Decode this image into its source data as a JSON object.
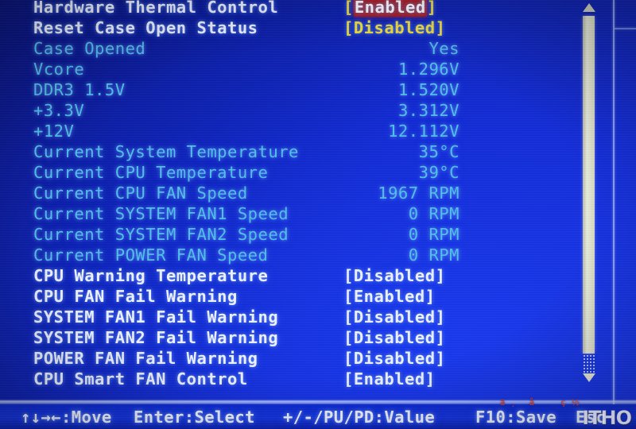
{
  "screen": {
    "background_color": "#0a22c8",
    "highlight_color": "#b11a1a",
    "readonly_color": "#4fc3e8",
    "editable_color": "#eef2ff",
    "value_color": "#f2e03a"
  },
  "rows": [
    {
      "label": "Hardware Thermal Control",
      "value": "Enabled",
      "style": "bracket-selected"
    },
    {
      "label": "Reset Case Open Status",
      "value": "Disabled",
      "style": "bracket-yellow"
    },
    {
      "label": "Case Opened",
      "value": "Yes",
      "style": "readonly"
    },
    {
      "label": "Vcore",
      "value": "1.296V",
      "style": "readonly"
    },
    {
      "label": "DDR3 1.5V",
      "value": "1.520V",
      "style": "readonly"
    },
    {
      "label": "+3.3V",
      "value": "3.312V",
      "style": "readonly"
    },
    {
      "label": "+12V",
      "value": "12.112V",
      "style": "readonly"
    },
    {
      "label": "Current System Temperature",
      "value": "35°C",
      "style": "readonly"
    },
    {
      "label": "Current CPU Temperature",
      "value": "39°C",
      "style": "readonly"
    },
    {
      "label": "Current CPU FAN Speed",
      "value": "1967 RPM",
      "style": "readonly"
    },
    {
      "label": "Current SYSTEM FAN1 Speed",
      "value": "0 RPM",
      "style": "readonly"
    },
    {
      "label": "Current SYSTEM FAN2 Speed",
      "value": "0 RPM",
      "style": "readonly"
    },
    {
      "label": "Current POWER FAN Speed",
      "value": "0 RPM",
      "style": "readonly"
    },
    {
      "label": "CPU Warning Temperature",
      "value": "Disabled",
      "style": "bracket-white"
    },
    {
      "label": "CPU FAN Fail Warning",
      "value": "Enabled",
      "style": "bracket-white"
    },
    {
      "label": "SYSTEM FAN1 Fail Warning",
      "value": "Disabled",
      "style": "bracket-white"
    },
    {
      "label": "SYSTEM FAN2 Fail Warning",
      "value": "Disabled",
      "style": "bracket-white"
    },
    {
      "label": "POWER FAN Fail Warning",
      "value": "Disabled",
      "style": "bracket-white"
    },
    {
      "label": "CPU Smart FAN Control",
      "value": "Enabled",
      "style": "bracket-white"
    }
  ],
  "scrollbar": {
    "up_arrow": "scroll-up-arrow",
    "down_arrow": "scroll-down-arrow"
  },
  "footer": {
    "items": [
      {
        "key": "↑↓→←",
        "action": "Move",
        "text": "↑↓→←:Move"
      },
      {
        "key": "Enter",
        "action": "Select",
        "text": "Enter:Select"
      },
      {
        "key": "+/-/PU/PD",
        "action": "Value",
        "text": "+/-/PU/PD:Value"
      },
      {
        "key": "F10",
        "action": "Save",
        "text": "F10:Save"
      },
      {
        "key": "Esc",
        "action": "",
        "text": "Esc"
      }
    ]
  },
  "watermark": {
    "cjk": "ä¸­ å ç½",
    "logo": "ITHO"
  }
}
